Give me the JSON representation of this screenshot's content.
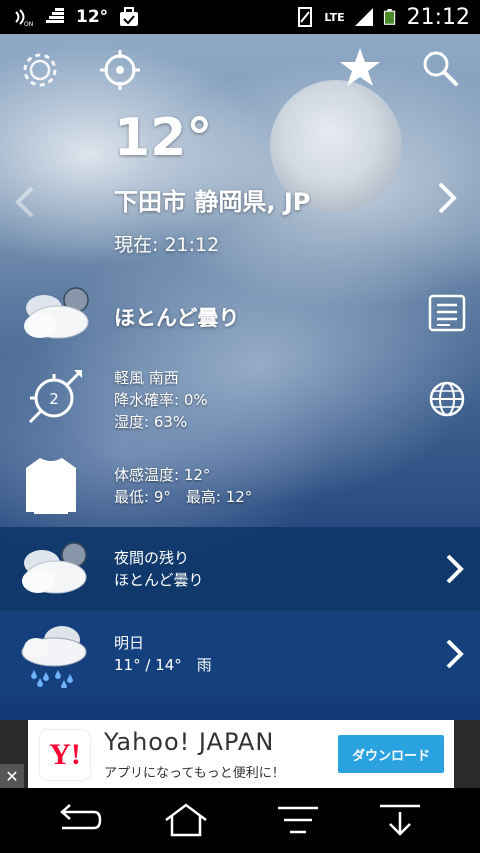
{
  "status_bar": {
    "temperature": "12°",
    "network": "LTE",
    "battery": "57",
    "time": "21:12"
  },
  "weather": {
    "temperature": "12°",
    "location": "下田市 静岡県, JP",
    "current_time": "現在: 21:12",
    "condition": "ほとんど曇り",
    "wind": "軽風 南西",
    "wind_speed": "2",
    "precipitation": "降水確率: 0%",
    "humidity": "湿度: 63%",
    "feels_like": "体感温度: 12°",
    "min_max": "最低: 9°　最高: 12°"
  },
  "forecast": [
    {
      "title": "夜間の残り",
      "detail": "ほとんど曇り"
    },
    {
      "title": "明日",
      "detail": "11° / 14°　雨"
    }
  ],
  "ad": {
    "logo": "Y!",
    "title": "Yahoo! JAPAN",
    "subtitle": "アプリになってもっと便利に！",
    "button": "ダウンロード",
    "close": "✕"
  },
  "icons": {
    "settings": "gear-icon",
    "locate": "crosshair-icon",
    "favorite": "star-icon",
    "search": "search-icon",
    "details": "document-icon",
    "map": "globe-icon"
  }
}
